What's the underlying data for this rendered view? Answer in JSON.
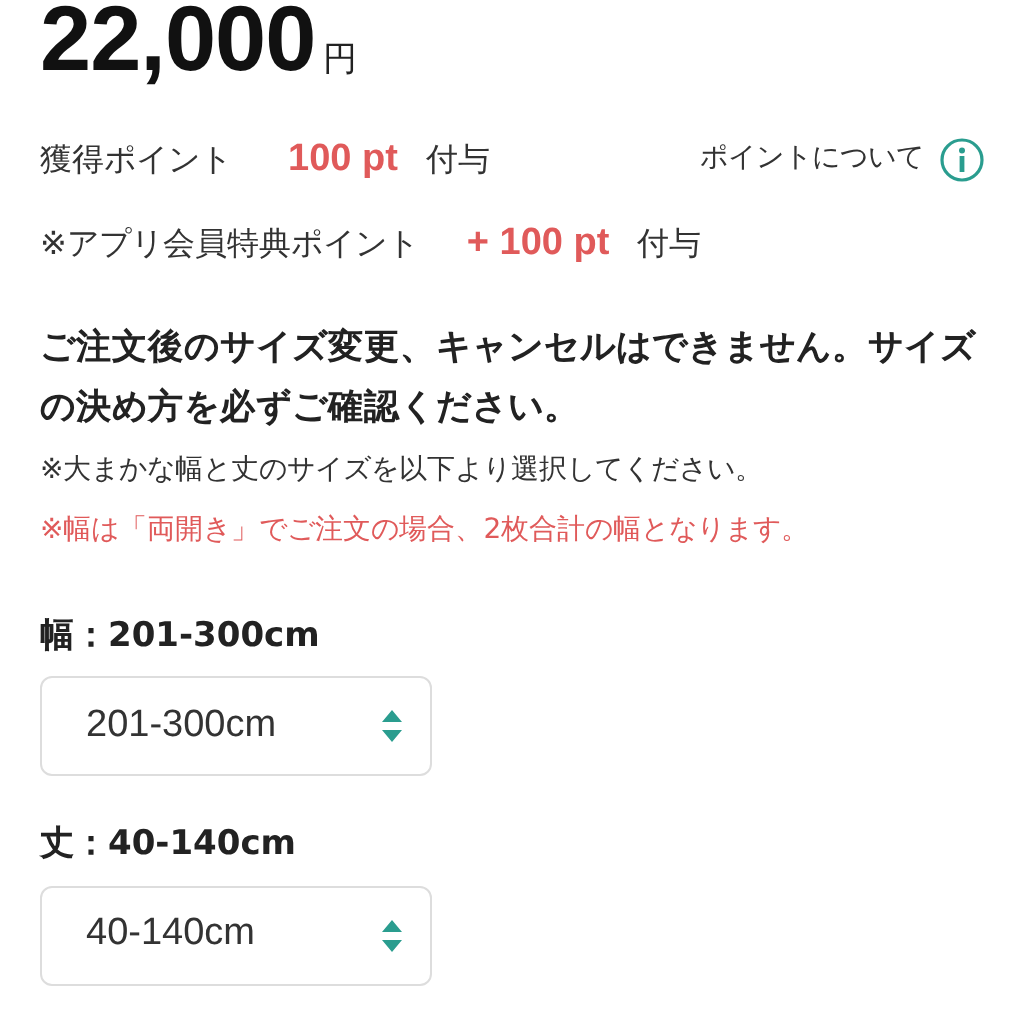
{
  "price": {
    "amount": "22,000",
    "unit": "円"
  },
  "points": [
    {
      "label": "獲得ポイント",
      "value": "100 pt",
      "suffix": "付与"
    },
    {
      "label": "※アプリ会員特典ポイント",
      "value": "+ 100 pt",
      "suffix": "付与"
    }
  ],
  "points_link": "ポイントについて",
  "notice": "ご注文後のサイズ変更、キャンセルはできません。サイズの決め方を必ずご確認ください。",
  "notes": [
    {
      "text": "※大まかな幅と丈のサイズを以下より選択してください。",
      "kind": "plain"
    },
    {
      "text": "※幅は「両開き」でご注文の場合、2枚合計の幅となります。",
      "kind": "warning"
    }
  ],
  "options": [
    {
      "label": "幅：201-300cm",
      "value": "201-300cm"
    },
    {
      "label": "丈：40-140cm",
      "value": "40-140cm"
    }
  ]
}
